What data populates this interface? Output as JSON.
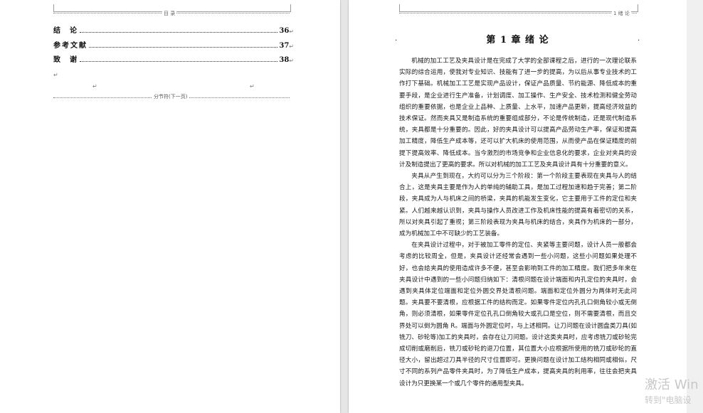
{
  "left_page": {
    "header_label": "目 录",
    "toc": [
      {
        "title": "结  论",
        "page": "36"
      },
      {
        "title": "参考文献",
        "page": "37"
      },
      {
        "title": "致  谢",
        "page": "38"
      }
    ],
    "section_break_label": "分节符(下一页)"
  },
  "right_page": {
    "header_label": "1 绪 论",
    "chapter_title": "第 1 章  绪  论",
    "paragraphs": [
      "机械的加工工艺及夹具设计是在完成了大学的全部课程之后，进行的一次理论联系实际的综合运用，使我对专业知识、技能有了进一步的提高，为以后从事专业技术的工作打下基础。机械加工工艺是实现产品设计，保证产品质量、节约能源、降低成本的重要手段，是企业进行生产准备，计划调度、加工操作、生产安全、技术检测和健全劳动组织的重要依据，也是企业上品种、上质量、上水平，加速产品更新，提高经济效益的技术保证。然而夹具又是制造系统的重要组成部分，不论是传统制造，还是现代制造系统，夹具都是十分重要的。因此，好的夹具设计可以提高产品劳动生产率，保证和提高加工精度，降低生产成本等，还可以扩大机床的使用范围，从而使产品在保证精度的前提下提高效率、降低成本。当今激烈的市场竞争和企业信息化的要求，企业对夹具的设计及制造提出了更高的要求。所以对机械的加工工艺及夹具设计具有十分重要的意义。",
      "夹具从产生到现在，大约可以分为三个阶段：第一个阶段主要表现在夹具与人的结合上，这是夹具主要是作为人的单纯的辅助工具，是加工过程加速和趋于完善；第二阶段，夹具成为人与机床之间的桥梁，夹具的机能发生变化，它主要用于工件的定位和夹紧。人们越来越认识到，夹具与操作人员改进工作及机床性能的提高有着密切的关系，所以对夹具引起了重视；第三阶段表现为夹具与机床的结合，夹具作为机床的一部分，成为机械加工中不可缺少的工艺装备。",
      "在夹具设计过程中，对于被加工零件的定位、夹紧等主要问题，设计人员一般都会考虑的比较周全，但是，夹具设计还经常会遇到一些小问题，这些小问题如果处理不好，也会给夹具的使用造成许多不便，甚至会影响到工件的加工精度。我们把多年来在夹具设计中遇到的一些小问题归纳如下：清根问题在设计端面和内孔定位的夹具时，会遇到夹具体定位端面和定位外圆交界处清根问题。端面和定位外圆分为两体时无此问题。夹具要不要清根，应根据工件的结构而定。如果零件定位内孔孔口倒角较小或无倒角，则必须清根，如果零件定位孔孔口倒角较大或孔口是空位，则不需要清根，而且交界处可以倒为圆角 R。端面与外圆定位时，与上述相同。让刀问题在设计圆盘类刀具(如铣刀、砂轮等)加工的夹具时，会存在让刀问题。设计这类夹具时，应考虑铣刀或砂轮完成切削或磨削后，铣刀或砂轮的退刀位置，其位置大小应根据所使用的铣刀或砂轮的直径大小，留出超过刀具半径的尺寸位置即可。更换问题在设计加工结构相同或相似，尺寸不同的系列产品零件夹具时，为了降低生产成本，提高夹具的利用率，往往会把夹具设计为只更换某一个或几个零件的通用型夹具。"
    ]
  },
  "watermark": {
    "line1": "激活 Win",
    "line2": "转到\"电脑设"
  },
  "colors": {
    "canvas": "#e6e6e6",
    "page": "#ffffff",
    "text": "#111111"
  }
}
